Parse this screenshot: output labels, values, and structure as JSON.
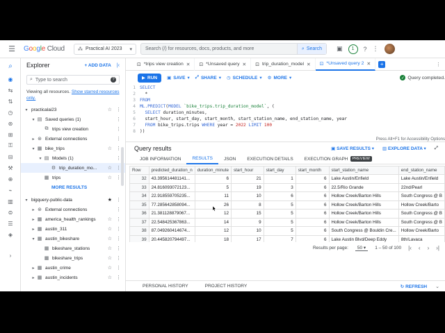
{
  "topbar": {
    "logo": "Google Cloud",
    "project": "Practical AI 2023",
    "search_placeholder": "Search (/) for resources, docs, products, and more",
    "search_button": "Search",
    "notifications_count": "1"
  },
  "explorer": {
    "title": "Explorer",
    "add_data": "+ ADD DATA",
    "search_placeholder": "Type to search",
    "info_text": "Viewing all resources.",
    "info_link": "Show starred resources only.",
    "more_results": "MORE RESULTS",
    "tree": [
      {
        "label": "practicalai23",
        "level": 0,
        "chev": "▾",
        "icon": "",
        "star": "☆"
      },
      {
        "label": "Saved queries (1)",
        "level": 1,
        "chev": "▾",
        "icon": "▤",
        "star": ""
      },
      {
        "label": "trips view creation",
        "level": 2,
        "chev": "",
        "icon": "⧉",
        "star": ""
      },
      {
        "label": "External connections",
        "level": 1,
        "chev": "▸",
        "icon": "⊛",
        "star": ""
      },
      {
        "label": "bike_trips",
        "level": 1,
        "chev": "▾",
        "icon": "▦",
        "star": "☆"
      },
      {
        "label": "Models (1)",
        "level": 2,
        "chev": "▾",
        "icon": "▤",
        "star": ""
      },
      {
        "label": "trip_duration_mo...",
        "level": 3,
        "chev": "",
        "icon": "⚙",
        "star": "☆",
        "selected": true
      },
      {
        "label": "trips",
        "level": 2,
        "chev": "",
        "icon": "▦",
        "star": "☆"
      }
    ],
    "tree2": [
      {
        "label": "bigquery-public-data",
        "level": 0,
        "chev": "▾",
        "icon": "",
        "star": "★"
      },
      {
        "label": "External connections",
        "level": 1,
        "chev": "▸",
        "icon": "⊛",
        "star": ""
      },
      {
        "label": "america_health_rankings",
        "level": 1,
        "chev": "▸",
        "icon": "▦",
        "star": "☆"
      },
      {
        "label": "austin_311",
        "level": 1,
        "chev": "▸",
        "icon": "▦",
        "star": "☆"
      },
      {
        "label": "austin_bikeshare",
        "level": 1,
        "chev": "▾",
        "icon": "▦",
        "star": "☆"
      },
      {
        "label": "bikeshare_stations",
        "level": 2,
        "chev": "",
        "icon": "▦",
        "star": "☆"
      },
      {
        "label": "bikeshare_trips",
        "level": 2,
        "chev": "",
        "icon": "▦",
        "star": "☆"
      },
      {
        "label": "austin_crime",
        "level": 1,
        "chev": "▸",
        "icon": "▦",
        "star": "☆"
      },
      {
        "label": "austin_incidents",
        "level": 1,
        "chev": "▸",
        "icon": "▦",
        "star": "☆"
      }
    ]
  },
  "tabs": [
    {
      "label": "*trips view creation",
      "active": false
    },
    {
      "label": "*Unsaved query",
      "active": false
    },
    {
      "label": "trip_duration_model",
      "active": false
    },
    {
      "label": "*Unsaved query 2",
      "active": true
    }
  ],
  "toolbar": {
    "run": "RUN",
    "save": "SAVE",
    "share": "SHARE",
    "schedule": "SCHEDULE",
    "more": "MORE",
    "status": "Query completed."
  },
  "editor": {
    "lines": [
      {
        "n": "1",
        "code": "SELECT"
      },
      {
        "n": "2",
        "code": "  *"
      },
      {
        "n": "3",
        "code": "FROM"
      },
      {
        "n": "4",
        "code": "ML.PREDICT(MODEL `bike_trips.trip_duration_model`, ("
      },
      {
        "n": "5",
        "code": "  SELECT duration_minutes,"
      },
      {
        "n": "6",
        "code": "  start_hour, start_day, start_month, start_station_name, end_station_name, year"
      },
      {
        "n": "7",
        "code": "  FROM bike_trips.trips WHERE year = 2022 LIMIT 100"
      },
      {
        "n": "8",
        "code": "))"
      }
    ],
    "a11y_hint": "Press Alt+F1 for Accessibility Options"
  },
  "results": {
    "title": "Query results",
    "save_results": "SAVE RESULTS",
    "explore_data": "EXPLORE DATA",
    "tabs": [
      "JOB INFORMATION",
      "RESULTS",
      "JSON",
      "EXECUTION DETAILS",
      "EXECUTION GRAPH"
    ],
    "preview_badge": "PREVIEW",
    "columns": [
      "Row",
      "predicted_duration_n",
      "duration_minute",
      "start_hour",
      "start_day",
      "start_month",
      "start_station_name",
      "end_station_name"
    ],
    "rows": [
      [
        "32",
        "43.395614481141...",
        "6",
        "21",
        "1",
        "6",
        "Lake Austin/Enfield",
        "Lake Austin/Enfield"
      ],
      [
        "33",
        "24.816093072123...",
        "5",
        "19",
        "3",
        "6",
        "22.5/Rio Grande",
        "22nd/Pearl"
      ],
      [
        "34",
        "22.918559705235...",
        "11",
        "10",
        "6",
        "6",
        "Hollow Creek/Barton Hills",
        "South Congress @ B"
      ],
      [
        "35",
        "77.285642858094...",
        "26",
        "8",
        "5",
        "6",
        "Hollow Creek/Barton Hills",
        "Hollow Creek/Barto"
      ],
      [
        "36",
        "21.381128879067...",
        "12",
        "15",
        "5",
        "6",
        "Hollow Creek/Barton Hills",
        "South Congress @ B"
      ],
      [
        "37",
        "22.548425367863...",
        "14",
        "9",
        "5",
        "6",
        "Hollow Creek/Barton Hills",
        "South Congress @ B"
      ],
      [
        "38",
        "87.049260414674...",
        "12",
        "10",
        "5",
        "6",
        "South Congress @ Bouldin Cre...",
        "Hollow Creek/Barto"
      ],
      [
        "39",
        "20.445820794497...",
        "18",
        "17",
        "7",
        "6",
        "Lake Austin Blvd/Deep Eddy",
        "8th/Lavaca"
      ]
    ],
    "results_per_page_label": "Results per page:",
    "results_per_page": "50",
    "range": "1 – 50 of 100"
  },
  "bottom": {
    "personal_history": "PERSONAL HISTORY",
    "project_history": "PROJECT HISTORY",
    "refresh": "REFRESH"
  }
}
